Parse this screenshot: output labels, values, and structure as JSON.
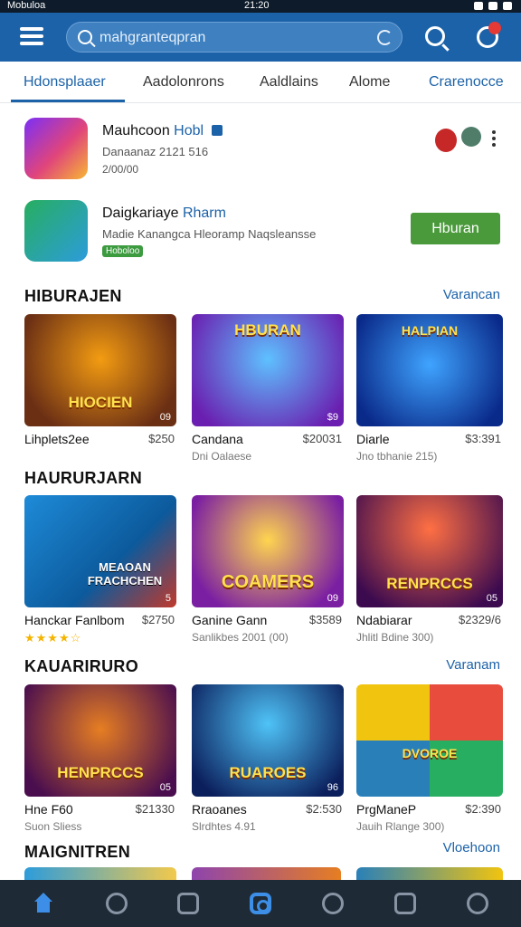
{
  "status_bar": {
    "left": "Mobuloa",
    "time": "21:20"
  },
  "search": {
    "placeholder": "mahgranteqpran"
  },
  "tabs": [
    {
      "label": "Hdonsplaaer",
      "active": true
    },
    {
      "label": "Aadolonrons",
      "active": false
    },
    {
      "label": "Aaldlains",
      "active": false
    },
    {
      "label": "Alome",
      "active": false
    },
    {
      "label": "Crarenocce",
      "active": false
    }
  ],
  "featured": [
    {
      "title": "Mauhcoon",
      "title_highlight": "Hobl",
      "line1": "Danaanaz 2121 516",
      "line2": "2/00/00"
    },
    {
      "title": "Daigkariaye",
      "title_highlight": "Rharm",
      "line1": "Madie Kanangca Hleoramp Naqsleansse",
      "tag": "Hoboloo",
      "button": "Hburan"
    }
  ],
  "sections": [
    {
      "title": "HIBURAJEN",
      "link": "Varancan",
      "cards": [
        {
          "art": "HIOCIEN",
          "corner": "09",
          "name": "Lihplets2ee",
          "price": "$250",
          "meta": ""
        },
        {
          "art": "HBURAN",
          "corner": "$9",
          "name": "Candana",
          "price": "$20031",
          "meta": "Dni Oalaese"
        },
        {
          "art": "HALPIAN",
          "corner": "",
          "name": "Diarle",
          "price": "$3:391",
          "meta": "Jno tbhanie 215)"
        }
      ]
    },
    {
      "title": "HAURURJARN",
      "link": "",
      "cards": [
        {
          "art": "MEAOAN FRACHCHEN",
          "corner": "5",
          "name": "Hanckar Fanlbom",
          "price": "$2750",
          "meta": "",
          "rating": 4
        },
        {
          "art": "COAMERS",
          "corner": "09",
          "name": "Ganine Gann",
          "price": "$3589",
          "meta": "Sanlikbes 2001 (00)"
        },
        {
          "art": "RENPRCCS",
          "corner": "05",
          "name": "Ndabiarar",
          "price": "$2329/6",
          "meta": "Jhlitl Bdine 300)"
        }
      ]
    },
    {
      "title": "KAUARIRURO",
      "link": "Varanam",
      "cards": [
        {
          "art": "HENPRCCS",
          "corner": "05",
          "name": "Hne F60",
          "price": "$21330",
          "meta": "Suon Sliess"
        },
        {
          "art": "RUAROES",
          "corner": "96",
          "name": "Rraoanes",
          "price": "$2:530",
          "meta": "Slrdhtes 4.91"
        },
        {
          "art": "DVOROE",
          "corner": "",
          "name": "PrgManeP",
          "price": "$2:390",
          "meta": "Jauih Rlange 300)"
        }
      ]
    },
    {
      "title": "MAIGNITREN",
      "link": "Vloehoon",
      "cards": []
    }
  ],
  "colors": {
    "accent": "#1c62a8",
    "button_green": "#4a9a3b",
    "nav_bg": "#1e2a36"
  },
  "bottom_nav": [
    "home-icon",
    "user-icon",
    "tablet-icon",
    "camera-icon",
    "heart-icon",
    "list-icon",
    "profile-icon"
  ]
}
